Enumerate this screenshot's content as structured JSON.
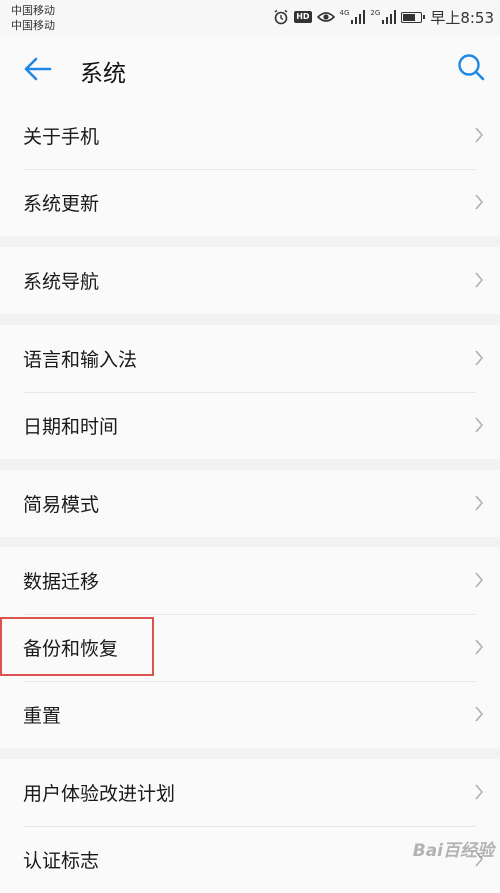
{
  "status_bar": {
    "carrier_1": "中国移动",
    "carrier_2": "中国移动",
    "hd_badge": "HD",
    "network_1": "4G",
    "network_2": "2G",
    "battery_level_fraction": 0.75,
    "time": "早上8:53",
    "icons": [
      "alarm-icon",
      "eye-icon",
      "signal-icon",
      "battery-icon"
    ]
  },
  "app_bar": {
    "title": "系统",
    "back_icon": "back-arrow-icon",
    "search_icon": "search-icon",
    "accent_color": "#1e88e5"
  },
  "settings_groups": [
    {
      "items": [
        {
          "label": "关于手机"
        },
        {
          "label": "系统更新"
        }
      ]
    },
    {
      "items": [
        {
          "label": "系统导航"
        }
      ]
    },
    {
      "items": [
        {
          "label": "语言和输入法"
        },
        {
          "label": "日期和时间"
        }
      ]
    },
    {
      "items": [
        {
          "label": "简易模式"
        }
      ]
    },
    {
      "items": [
        {
          "label": "数据迁移"
        },
        {
          "label": "备份和恢复",
          "highlighted": true
        },
        {
          "label": "重置"
        }
      ]
    },
    {
      "items": [
        {
          "label": "用户体验改进计划"
        },
        {
          "label": "认证标志"
        }
      ]
    }
  ],
  "highlight_color": "#d9534f",
  "watermark": "Bai百经验"
}
